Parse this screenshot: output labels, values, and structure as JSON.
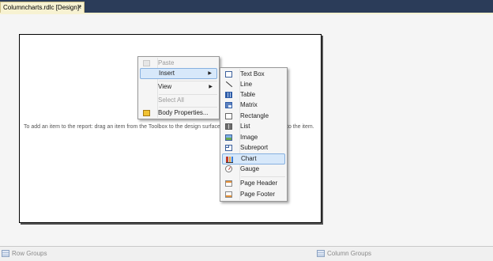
{
  "tab": {
    "title": "Columncharts.rdlc [Design]*",
    "close": "×"
  },
  "design_surface": {
    "hint_start": "To add an item to the report: drag an item from the Toolbox to the design surface,",
    "hint_end": "to the item."
  },
  "context_menu": {
    "items": [
      {
        "label": "Paste",
        "icon": "paste-icon",
        "disabled": true
      },
      {
        "label": "Insert",
        "submenu": true,
        "highlighted": true
      },
      {
        "label": "View",
        "submenu": true
      },
      {
        "label": "Select All",
        "disabled": true
      },
      {
        "label": "Body Properties...",
        "icon": "body-properties-icon"
      }
    ]
  },
  "insert_submenu": {
    "items": [
      {
        "label": "Text Box",
        "icon": "textbox-icon"
      },
      {
        "label": "Line",
        "icon": "line-icon"
      },
      {
        "label": "Table",
        "icon": "table-icon"
      },
      {
        "label": "Matrix",
        "icon": "matrix-icon"
      },
      {
        "label": "Rectangle",
        "icon": "rectangle-icon"
      },
      {
        "label": "List",
        "icon": "list-icon"
      },
      {
        "label": "Image",
        "icon": "image-icon"
      },
      {
        "label": "Subreport",
        "icon": "subreport-icon"
      },
      {
        "label": "Chart",
        "icon": "chart-icon",
        "highlighted": true
      },
      {
        "label": "Gauge",
        "icon": "gauge-icon"
      },
      {
        "label": "Page Header",
        "icon": "page-header-icon"
      },
      {
        "label": "Page Footer",
        "icon": "page-footer-icon"
      }
    ]
  },
  "groups_bar": {
    "row_groups": "Row Groups",
    "column_groups": "Column Groups"
  },
  "colors": {
    "title_bar": "#2b3c59",
    "tab": "#f7f2d2",
    "highlight": "#d7e8fa",
    "highlight_border": "#86b0e0"
  }
}
